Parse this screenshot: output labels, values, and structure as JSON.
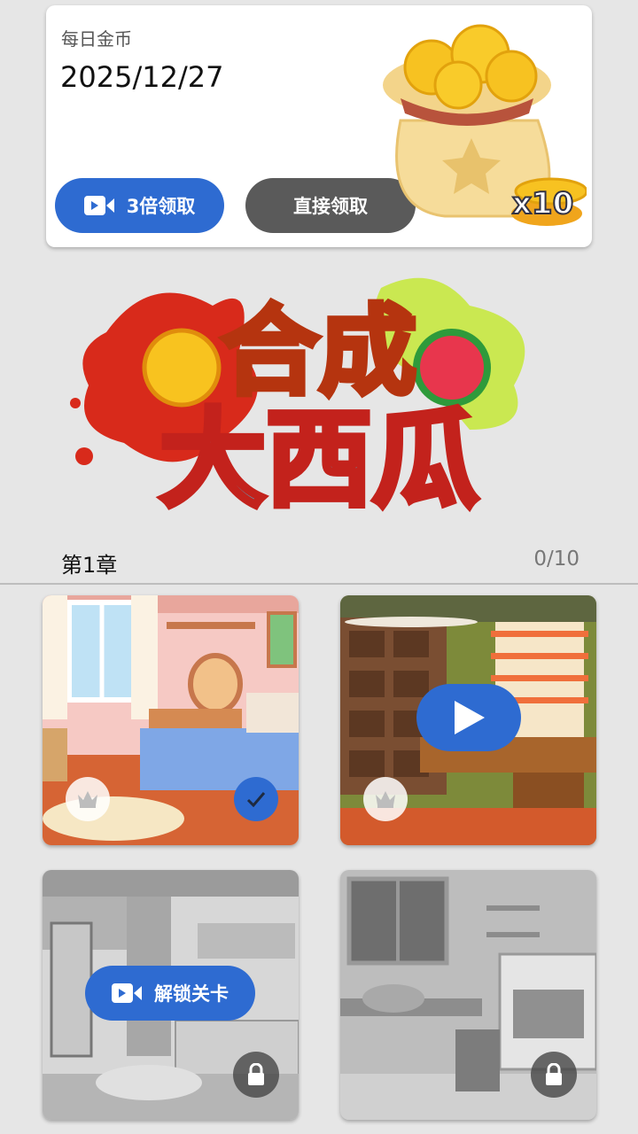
{
  "daily_coins": {
    "title": "每日金币",
    "date": "2025/12/27",
    "triple_label": "3倍领取",
    "direct_label": "直接领取",
    "reward_count": "x10"
  },
  "logo": {
    "text_top": "合成",
    "text_bottom": "大西瓜"
  },
  "chapter": {
    "title": "第1章",
    "progress": "0/10"
  },
  "levels": [
    {
      "state": "completed",
      "scene": "bedroom"
    },
    {
      "state": "play",
      "scene": "office"
    },
    {
      "state": "locked",
      "scene": "living-room",
      "unlock_label": "解锁关卡"
    },
    {
      "state": "locked",
      "scene": "kitchen"
    }
  ],
  "colors": {
    "accent": "#2e6bd1",
    "secondary": "#5a5a5a",
    "background": "#e6e6e6"
  }
}
